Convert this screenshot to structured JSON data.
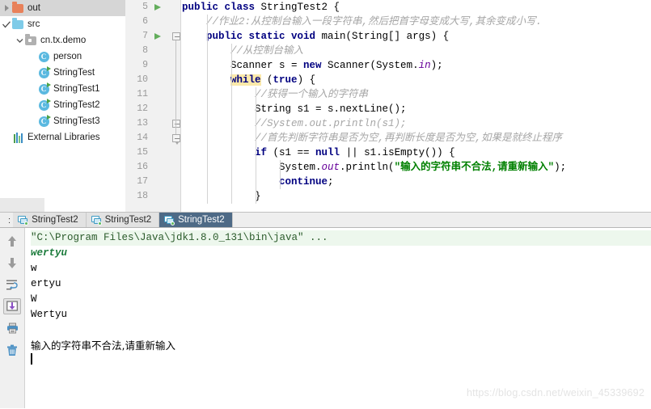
{
  "project_tree": {
    "items": [
      {
        "twisty": "right",
        "icon": "folder-out-icon",
        "label": "out",
        "selected": true,
        "indent": 0
      },
      {
        "twisty": "check",
        "icon": "folder-src-icon",
        "label": "src",
        "selected": false,
        "indent": 0
      },
      {
        "twisty": "down",
        "icon": "folder-package-icon",
        "label": "cn.tx.demo",
        "selected": false,
        "indent": 1
      },
      {
        "twisty": "none",
        "icon": "class-icon",
        "label": "person",
        "selected": false,
        "indent": 2
      },
      {
        "twisty": "none",
        "icon": "class-runnable-icon",
        "label": "StringTest",
        "selected": false,
        "indent": 2
      },
      {
        "twisty": "none",
        "icon": "class-runnable-icon",
        "label": "StringTest1",
        "selected": false,
        "indent": 2
      },
      {
        "twisty": "none",
        "icon": "class-runnable-icon",
        "label": "StringTest2",
        "selected": false,
        "indent": 2
      },
      {
        "twisty": "none",
        "icon": "class-runnable-icon",
        "label": "StringTest3",
        "selected": false,
        "indent": 2
      },
      {
        "twisty": "none",
        "icon": "external-libraries-icon",
        "label": "External Libraries",
        "selected": false,
        "indent": 0
      }
    ]
  },
  "editor": {
    "gutter": {
      "first_line": 5,
      "last_line": 18,
      "line_numbers": [
        5,
        6,
        7,
        8,
        9,
        10,
        11,
        12,
        13,
        14,
        15,
        16,
        17,
        18
      ],
      "run_arrow_lines": [
        5,
        7
      ],
      "fold_lines": [
        7,
        13,
        14
      ]
    },
    "lines": [
      {
        "n": 5,
        "tokens": [
          {
            "t": "kw",
            "v": "public class "
          },
          {
            "t": "plain",
            "v": "StringTest2 {"
          }
        ]
      },
      {
        "n": 6,
        "tokens": [
          {
            "t": "plain",
            "v": "    "
          },
          {
            "t": "cmt",
            "v": "//作业2:从控制台输入一段字符串,然后把首字母变成大写,其余变成小写."
          }
        ]
      },
      {
        "n": 7,
        "tokens": [
          {
            "t": "plain",
            "v": "    "
          },
          {
            "t": "kw",
            "v": "public static void "
          },
          {
            "t": "plain",
            "v": "main(String[] args) {"
          }
        ]
      },
      {
        "n": 8,
        "tokens": [
          {
            "t": "plain",
            "v": "        "
          },
          {
            "t": "cmt",
            "v": "//从控制台输入"
          }
        ]
      },
      {
        "n": 9,
        "tokens": [
          {
            "t": "plain",
            "v": "        Scanner s = "
          },
          {
            "t": "kw",
            "v": "new "
          },
          {
            "t": "plain",
            "v": "Scanner(System."
          },
          {
            "t": "fld",
            "v": "in"
          },
          {
            "t": "plain",
            "v": ");"
          }
        ]
      },
      {
        "n": 10,
        "tokens": [
          {
            "t": "plain",
            "v": "        "
          },
          {
            "t": "kwhl",
            "v": "while"
          },
          {
            "t": "plain",
            "v": " ("
          },
          {
            "t": "kw",
            "v": "true"
          },
          {
            "t": "plain",
            "v": ") {"
          }
        ]
      },
      {
        "n": 11,
        "tokens": [
          {
            "t": "plain",
            "v": "            "
          },
          {
            "t": "cmt",
            "v": "//获得一个输入的字符串"
          }
        ]
      },
      {
        "n": 12,
        "tokens": [
          {
            "t": "plain",
            "v": "            String s1 = s.nextLine();"
          }
        ]
      },
      {
        "n": 13,
        "tokens": [
          {
            "t": "plain",
            "v": "            "
          },
          {
            "t": "cmt",
            "v": "//System.out.println(s1);"
          }
        ]
      },
      {
        "n": 14,
        "tokens": [
          {
            "t": "plain",
            "v": "            "
          },
          {
            "t": "cmt",
            "v": "//首先判断字符串是否为空,再判断长度是否为空,如果是就终止程序"
          }
        ]
      },
      {
        "n": 15,
        "tokens": [
          {
            "t": "plain",
            "v": "            "
          },
          {
            "t": "kw",
            "v": "if "
          },
          {
            "t": "plain",
            "v": "(s1 == "
          },
          {
            "t": "kw",
            "v": "null "
          },
          {
            "t": "plain",
            "v": "|| s1.isEmpty()) {"
          }
        ]
      },
      {
        "n": 16,
        "tokens": [
          {
            "t": "plain",
            "v": "                System."
          },
          {
            "t": "fld",
            "v": "out"
          },
          {
            "t": "plain",
            "v": ".println("
          },
          {
            "t": "str",
            "v": "\"输入的字符串不合法,请重新输入\""
          },
          {
            "t": "plain",
            "v": ");"
          }
        ]
      },
      {
        "n": 17,
        "tokens": [
          {
            "t": "plain",
            "v": "                "
          },
          {
            "t": "kw",
            "v": "continue"
          },
          {
            "t": "plain",
            "v": ";"
          }
        ]
      },
      {
        "n": 18,
        "tokens": [
          {
            "t": "plain",
            "v": "            }"
          }
        ]
      }
    ]
  },
  "run_window": {
    "tabs_prefix": ":",
    "tabs": [
      {
        "label": "StringTest2",
        "active": false
      },
      {
        "label": "StringTest2",
        "active": false
      },
      {
        "label": "StringTest2",
        "active": true
      }
    ],
    "sidebar_buttons": [
      {
        "name": "up-arrow-icon",
        "title": "Up"
      },
      {
        "name": "down-arrow-icon",
        "title": "Down"
      },
      {
        "name": "soft-wrap-icon",
        "title": "Soft-Wrap"
      },
      {
        "name": "scroll-to-end-icon",
        "title": "Scroll to End"
      },
      {
        "name": "print-icon",
        "title": "Print"
      },
      {
        "name": "trash-icon",
        "title": "Clear All"
      }
    ],
    "console_lines": [
      {
        "kind": "cmdline",
        "text": "\"C:\\Program Files\\Java\\jdk1.8.0_131\\bin\\java\" ..."
      },
      {
        "kind": "input",
        "text": "wertyu"
      },
      {
        "kind": "out",
        "text": "w"
      },
      {
        "kind": "out",
        "text": "ertyu"
      },
      {
        "kind": "out",
        "text": "W"
      },
      {
        "kind": "out",
        "text": "Wertyu"
      },
      {
        "kind": "blank",
        "text": ""
      },
      {
        "kind": "zh",
        "text": "输入的字符串不合法,请重新输入"
      },
      {
        "kind": "caret",
        "text": ""
      }
    ]
  },
  "watermark": {
    "text": "https://blog.csdn.net/weixin_45339692"
  },
  "colors": {
    "keyword": "#000080",
    "comment": "#a6a6a6",
    "string": "#008000",
    "field": "#660099",
    "highlight": "#fbe9aa",
    "tab_active_bg": "#4e6a86",
    "selection_bg": "#d6d6d6",
    "gutter_bg": "#f1f1f1",
    "console_cmd_bg": "#edf7ed"
  }
}
